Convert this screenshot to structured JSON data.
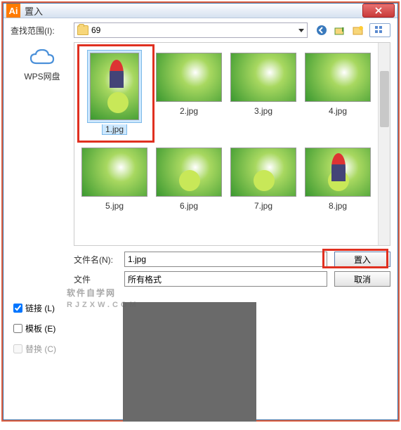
{
  "dialog": {
    "title": "置入",
    "look_in_label": "查找范围(I):",
    "look_in_value": "69",
    "filename_label": "文件名(N):",
    "filename_value": "1.jpg",
    "filetype_label": "文件",
    "filetype_value": "所有格式"
  },
  "sidebar": {
    "wps_label": "WPS网盘"
  },
  "files": [
    {
      "name": "1.jpg",
      "selected": true,
      "shape": "tall",
      "style": "char apple"
    },
    {
      "name": "2.jpg",
      "selected": false,
      "shape": "wide",
      "style": ""
    },
    {
      "name": "3.jpg",
      "selected": false,
      "shape": "wide",
      "style": ""
    },
    {
      "name": "4.jpg",
      "selected": false,
      "shape": "wide",
      "style": ""
    },
    {
      "name": "5.jpg",
      "selected": false,
      "shape": "wide",
      "style": ""
    },
    {
      "name": "6.jpg",
      "selected": false,
      "shape": "wide",
      "style": "apple"
    },
    {
      "name": "7.jpg",
      "selected": false,
      "shape": "wide",
      "style": "apple"
    },
    {
      "name": "8.jpg",
      "selected": false,
      "shape": "wide",
      "style": "char apple"
    }
  ],
  "buttons": {
    "place": "置入",
    "cancel": "取消"
  },
  "options": {
    "link": "链接 (L)",
    "template": "模板 (E)",
    "replace": "替换 (C)",
    "link_checked": true,
    "template_checked": false,
    "replace_checked": false
  },
  "watermark": {
    "main": "软件自学网",
    "sub": "RJZXW.COM"
  }
}
